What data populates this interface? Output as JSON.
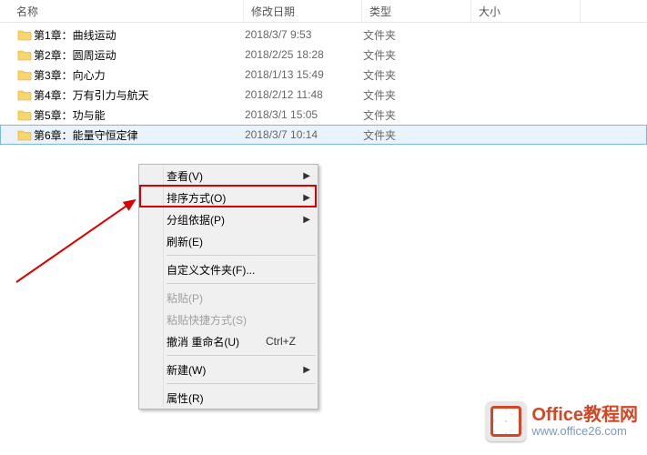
{
  "columns": {
    "name": "名称",
    "date": "修改日期",
    "type": "类型",
    "size": "大小"
  },
  "items": [
    {
      "name": "第1章：曲线运动",
      "date": "2018/3/7 9:53",
      "type": "文件夹",
      "selected": false
    },
    {
      "name": "第2章：圆周运动",
      "date": "2018/2/25 18:28",
      "type": "文件夹",
      "selected": false
    },
    {
      "name": "第3章：向心力",
      "date": "2018/1/13 15:49",
      "type": "文件夹",
      "selected": false
    },
    {
      "name": "第4章：万有引力与航天",
      "date": "2018/2/12 11:48",
      "type": "文件夹",
      "selected": false
    },
    {
      "name": "第5章：功与能",
      "date": "2018/3/1 15:05",
      "type": "文件夹",
      "selected": false
    },
    {
      "name": "第6章：能量守恒定律",
      "date": "2018/3/7 10:14",
      "type": "文件夹",
      "selected": true
    }
  ],
  "menu": {
    "view": "查看(V)",
    "sort": "排序方式(O)",
    "group": "分组依据(P)",
    "refresh": "刷新(E)",
    "custom": "自定义文件夹(F)...",
    "paste": "粘贴(P)",
    "paste_shortcut": "粘贴快捷方式(S)",
    "undo": "撤消 重命名(U)",
    "undo_key": "Ctrl+Z",
    "new": "新建(W)",
    "props": "属性(R)"
  },
  "watermark": {
    "title": "Office教程网",
    "url": "www.office26.com"
  }
}
